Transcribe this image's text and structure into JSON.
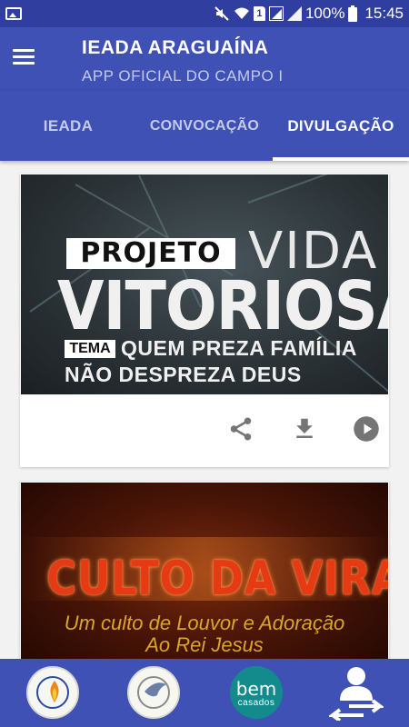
{
  "status_bar": {
    "battery": "100%",
    "time": "15:45",
    "sim_label": "1"
  },
  "app_bar": {
    "title": "IEADA ARAGUAÍNA",
    "subtitle": "APP OFICIAL DO CAMPO I"
  },
  "tabs": [
    {
      "label": "IEADA",
      "selected": false
    },
    {
      "label": "CONVOCAÇÃO",
      "selected": false
    },
    {
      "label": "DIVULGAÇÃO",
      "selected": true
    }
  ],
  "posts": [
    {
      "banner": {
        "tag": "PROJETO",
        "word1": "VIDA",
        "word2": "VITORIOSA",
        "theme_tag": "TEMA",
        "line1": "QUEM PREZA FAMÍLIA",
        "line2": "NÃO DESPREZA DEUS"
      },
      "actions": [
        "share-icon",
        "download-icon",
        "play-icon"
      ]
    },
    {
      "banner": {
        "title": "CULTO DA VIRADA",
        "line1": "Um culto de Louvor e Adoração",
        "line2": "Ao Rei Jesus"
      }
    }
  ],
  "bottom_bar": {
    "logo3": {
      "main": "bem",
      "sub": "casados"
    }
  },
  "colors": {
    "primary": "#3f51b5",
    "status_bar": "#303f9f",
    "tab_inactive_text": "#c5cae9",
    "action_icon": "#757575"
  }
}
